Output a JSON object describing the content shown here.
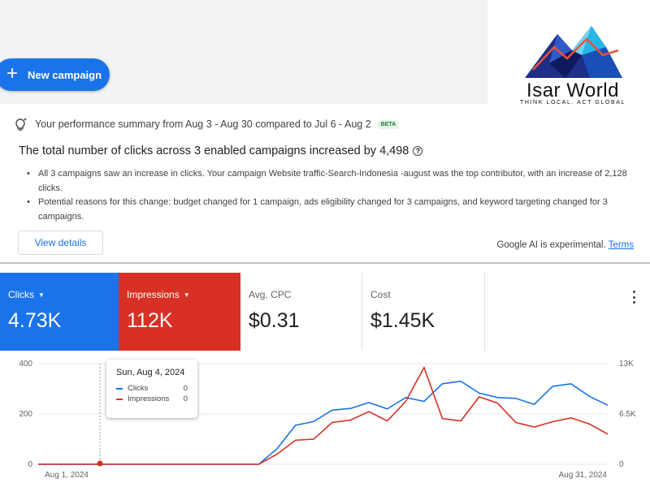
{
  "toolbar": {
    "new_campaign_label": "New campaign"
  },
  "logo": {
    "name": "Isar World",
    "tagline": "THINK LOCAL. ACT GLOBAL"
  },
  "summary": {
    "title": "Your performance summary from Aug 3 - Aug 30 compared to Jul 6 - Aug 2",
    "badge": "BETA",
    "headline": "The total number of clicks across 3 enabled campaigns increased by 4,498",
    "bullets": [
      "All 3 campaigns saw an increase in clicks. Your campaign Website traffic-Search-Indonesia -august was the top contributor, with an increase of 2,128 clicks.",
      "Potential reasons for this change: budget changed for 1 campaign, ads eligibility changed for 3 campaigns, and keyword targeting changed for 3 campaigns."
    ],
    "view_details_label": "View details",
    "ai_note": "Google AI is experimental.",
    "terms_label": "Terms"
  },
  "metrics": [
    {
      "label": "Clicks",
      "value": "4.73K",
      "color": "#1a73e8"
    },
    {
      "label": "Impressions",
      "value": "112K",
      "color": "#d93025"
    },
    {
      "label": "Avg. CPC",
      "value": "$0.31"
    },
    {
      "label": "Cost",
      "value": "$1.45K"
    }
  ],
  "tooltip": {
    "date": "Sun, Aug 4, 2024",
    "rows": [
      {
        "name": "Clicks",
        "value": "0"
      },
      {
        "name": "Impressions",
        "value": "0"
      }
    ]
  },
  "chart_data": {
    "type": "line",
    "x_start_label": "Aug 1, 2024",
    "x_end_label": "Aug 31, 2024",
    "left_axis_ticks": [
      "400",
      "200",
      "0"
    ],
    "right_axis_ticks": [
      "13K",
      "6.5K",
      "0"
    ],
    "ylim_left": [
      0,
      400
    ],
    "ylim_right": [
      0,
      13000
    ],
    "grid": true,
    "series": [
      {
        "name": "Clicks",
        "axis": "left",
        "color": "#1a73e8",
        "values": [
          0,
          0,
          0,
          0,
          0,
          0,
          0,
          0,
          0,
          0,
          0,
          0,
          0,
          62,
          155,
          170,
          215,
          222,
          245,
          220,
          265,
          250,
          320,
          330,
          283,
          265,
          262,
          238,
          310,
          320,
          270,
          235
        ]
      },
      {
        "name": "Impressions",
        "axis": "right",
        "color": "#d93025",
        "values": [
          0,
          0,
          0,
          0,
          0,
          0,
          0,
          0,
          0,
          0,
          0,
          0,
          0,
          1300,
          3100,
          3250,
          5400,
          5700,
          6800,
          5600,
          8100,
          12500,
          5900,
          5600,
          8700,
          7900,
          5400,
          4800,
          5500,
          6000,
          5200,
          3900
        ]
      }
    ]
  }
}
